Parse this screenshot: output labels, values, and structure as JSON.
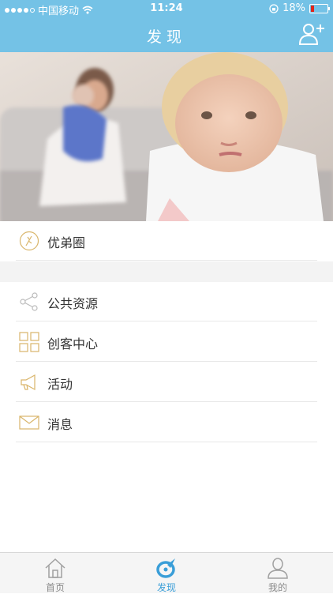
{
  "status_bar": {
    "carrier": "中国移动",
    "time": "11:24",
    "battery": "18%"
  },
  "nav": {
    "title": "发现"
  },
  "menu": [
    {
      "label": "优弟圈",
      "icon": "circle-pen-icon"
    },
    {
      "label": "公共资源",
      "icon": "share-icon"
    },
    {
      "label": "创客中心",
      "icon": "grid-icon"
    },
    {
      "label": "活动",
      "icon": "megaphone-icon"
    },
    {
      "label": "消息",
      "icon": "mail-icon"
    }
  ],
  "tabs": [
    {
      "label": "首页",
      "icon": "home-icon"
    },
    {
      "label": "发现",
      "icon": "compass-icon",
      "active": true
    },
    {
      "label": "我的",
      "icon": "user-icon"
    }
  ],
  "colors": {
    "accent": "#74c2e6",
    "active_tab": "#3a9ed8",
    "icon_gold": "#d9b56a"
  }
}
